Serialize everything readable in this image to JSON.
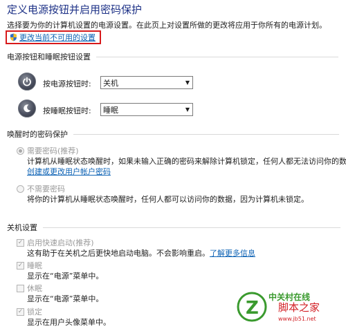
{
  "page": {
    "title": "定义电源按钮并启用密码保护",
    "description": "选择要为你的计算机设置的电源设置。在此页上对设置所做的更改将应用于你所有的电源计划。",
    "change_link": "更改当前不可用的设置"
  },
  "power_buttons": {
    "heading": "电源按钮和睡眠按钮设置",
    "power_label": "按电源按钮时:",
    "power_value": "关机",
    "sleep_label": "按睡眠按钮时:",
    "sleep_value": "睡眠"
  },
  "wake_password": {
    "heading": "唤醒时的密码保护",
    "require_label": "需要密码(推荐)",
    "require_desc": "计算机从睡眠状态唤醒时，如果未输入正确的密码来解除计算机锁定，任何人都无法访问你的数据。",
    "require_link": "创建或更改用户帐户密码",
    "norequire_label": "不需要密码",
    "norequire_desc": "将你的计算机从睡眠状态唤醒时，任何人都可以访问你的数据，因为计算机未锁定。"
  },
  "shutdown": {
    "heading": "关机设置",
    "items": [
      {
        "label": "启用快速启动(推荐)",
        "desc": "这有助于在关机之后更快地启动电脑。不会影响重启。",
        "link": "了解更多信息",
        "checked": true
      },
      {
        "label": "睡眠",
        "desc": "显示在“电源”菜单中。",
        "checked": true
      },
      {
        "label": "休眠",
        "desc": "显示在“电源”菜单中。",
        "checked": false
      },
      {
        "label": "锁定",
        "desc": "显示在用户头像菜单中。",
        "checked": true
      }
    ]
  },
  "watermark": {
    "brand": "中关村在线",
    "site_cn": "脚本之家",
    "site_url": "www.jb51.net"
  },
  "colors": {
    "title": "#1e3287",
    "link": "#0b61b4",
    "highlight_border": "#d7191b",
    "watermark_red": "#d21e23",
    "watermark_green": "#3a9a2e"
  }
}
